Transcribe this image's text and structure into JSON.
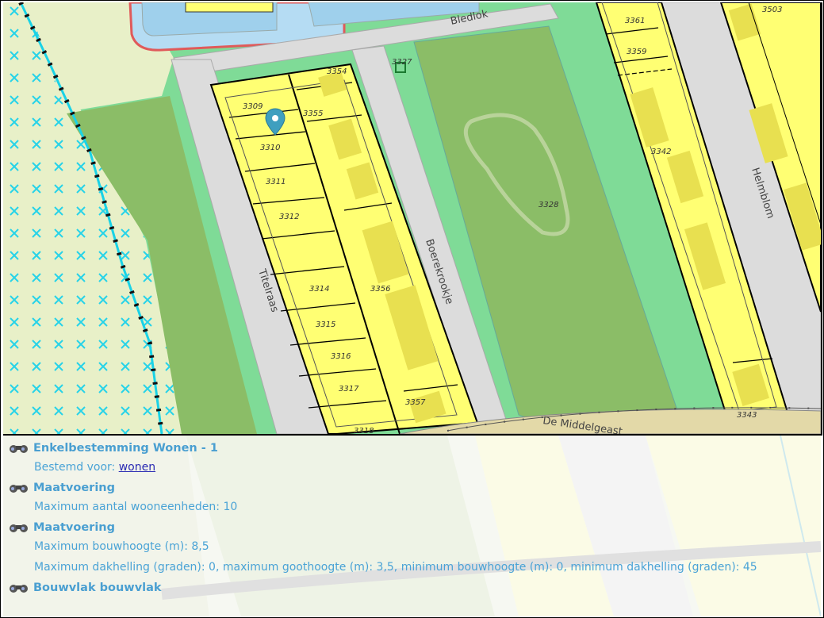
{
  "map": {
    "street_labels": {
      "bledlok": "Bledlok",
      "titelraas": "Titelraas",
      "boerekrookje": "Boerekrookje",
      "helmblom": "Helmblom",
      "de_middelgeast": "De Middelgeast"
    },
    "parcel_labels": {
      "p3309": "3309",
      "p3310": "3310",
      "p3311": "3311",
      "p3312": "3312",
      "p3314": "3314",
      "p3315": "3315",
      "p3316": "3316",
      "p3317": "3317",
      "p3318": "3318",
      "p3354": "3354",
      "p3355": "3355",
      "p3356": "3356",
      "p3357": "3357",
      "p3328": "3328",
      "p3361": "3361",
      "p3359": "3359",
      "p3342": "3342",
      "p3503": "3503",
      "p3343": "3343",
      "p3327": "3327"
    },
    "colors": {
      "residential": "#ffff73",
      "green": "#7fdb97",
      "park": "#8bbd67",
      "road": "#dcdcdc",
      "water": "#b5dcf3",
      "agricultural": "#e8f0c8",
      "marker": "#3f9fbf"
    },
    "marker_icon": "map-pin-icon"
  },
  "info": {
    "icon": "binoculars-icon",
    "entries": [
      {
        "title": "Enkelbestemming Wonen - 1",
        "lines": [
          {
            "text": "Bestemd voor: ",
            "link": "wonen"
          }
        ]
      },
      {
        "title": "Maatvoering",
        "lines": [
          {
            "text": "Maximum aantal wooneenheden: 10"
          }
        ]
      },
      {
        "title": "Maatvoering",
        "lines": [
          {
            "text": "Maximum bouwhoogte (m): 8,5"
          },
          {
            "text": "Maximum dakhelling (graden): 0, maximum goothoogte (m): 3,5, minimum bouwhoogte (m): 0, minimum dakhelling (graden): 45"
          }
        ]
      },
      {
        "title": "Bouwvlak bouwvlak",
        "lines": []
      }
    ]
  }
}
